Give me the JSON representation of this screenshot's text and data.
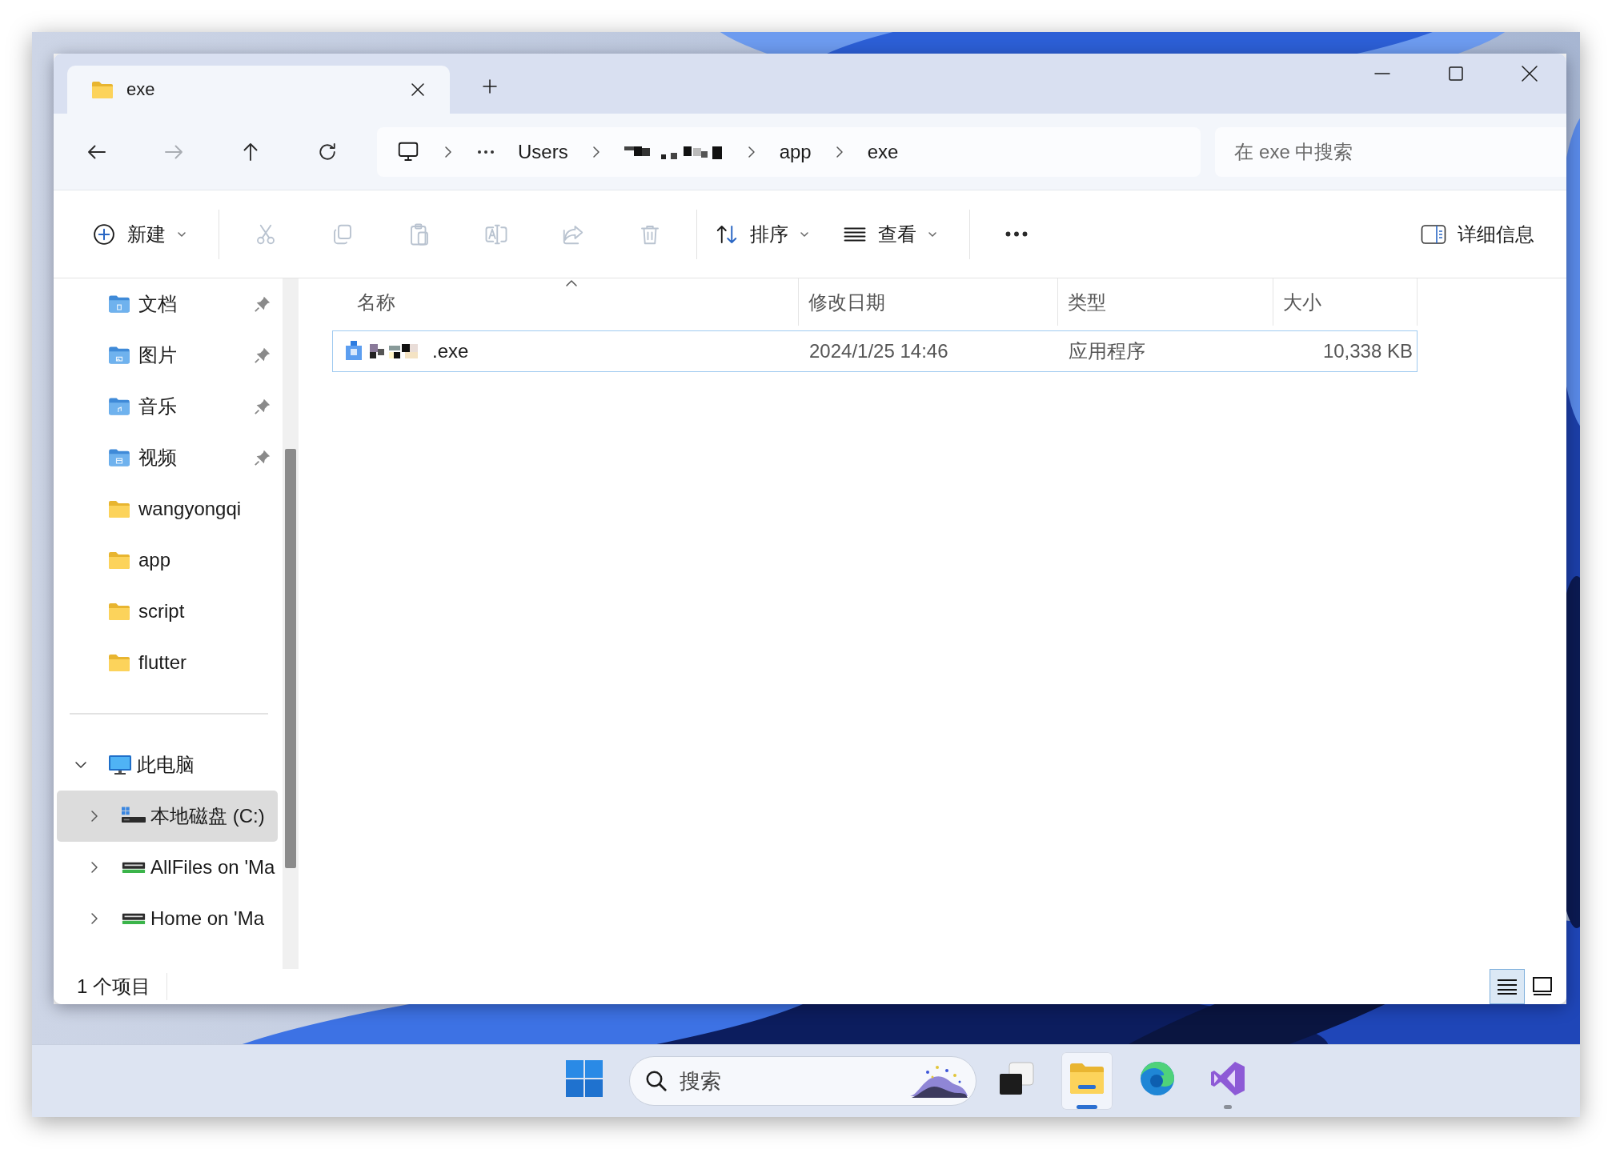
{
  "window": {
    "tabs": [
      {
        "label": "exe",
        "selected": true
      }
    ]
  },
  "navigation": {
    "buttons": [
      {
        "kind": "back",
        "disabled": false
      },
      {
        "kind": "forward",
        "disabled": true
      },
      {
        "kind": "up",
        "disabled": false
      },
      {
        "kind": "refresh",
        "disabled": false
      }
    ],
    "breadcrumb": [
      {
        "kind": "computer"
      },
      {
        "kind": "overflow"
      },
      {
        "kind": "folder",
        "label": "Users"
      },
      {
        "kind": "hidden"
      },
      {
        "kind": "folder",
        "label": "app"
      },
      {
        "kind": "folder",
        "label": "exe"
      }
    ]
  },
  "search": {
    "placeholder": "在 exe 中搜索"
  },
  "toolbar": {
    "items": [
      {
        "kind": "new",
        "label": "新建",
        "disabled": false
      },
      {
        "kind": "separator"
      },
      {
        "kind": "cut",
        "disabled": true
      },
      {
        "kind": "copy",
        "disabled": true
      },
      {
        "kind": "paste",
        "disabled": true
      },
      {
        "kind": "rename",
        "disabled": true
      },
      {
        "kind": "share",
        "disabled": true
      },
      {
        "kind": "delete",
        "disabled": true
      },
      {
        "kind": "separator"
      },
      {
        "kind": "sort",
        "label": "排序",
        "disabled": false
      },
      {
        "kind": "view",
        "label": "查看",
        "disabled": false
      },
      {
        "kind": "separator"
      },
      {
        "kind": "more",
        "disabled": false
      }
    ],
    "details": {
      "label": "详细信息"
    }
  },
  "sidebar": {
    "quick": [
      {
        "label": "文档",
        "kind": "documents",
        "pinned": true,
        "selected": false
      },
      {
        "label": "图片",
        "kind": "pictures",
        "pinned": true,
        "selected": false
      },
      {
        "label": "音乐",
        "kind": "music",
        "pinned": true,
        "selected": false
      },
      {
        "label": "视频",
        "kind": "videos",
        "pinned": true,
        "selected": false
      },
      {
        "label": "wangyongqi",
        "kind": "folder",
        "pinned": false,
        "selected": false
      },
      {
        "label": "app",
        "kind": "folder",
        "pinned": false,
        "selected": false
      },
      {
        "label": "script",
        "kind": "folder",
        "pinned": false,
        "selected": false
      },
      {
        "label": "flutter",
        "kind": "folder",
        "pinned": false,
        "selected": false
      }
    ],
    "tree": [
      {
        "label": "此电脑",
        "kind": "computer",
        "expanded": true,
        "selected": false,
        "children": [
          {
            "label": "本地磁盘 (C:)",
            "kind": "system-drive",
            "expanded": false,
            "selected": true
          },
          {
            "label": "AllFiles on 'Ma",
            "kind": "network-drive",
            "expanded": false,
            "selected": false
          },
          {
            "label": "Home on 'Ma",
            "kind": "network-drive",
            "expanded": false,
            "selected": false
          }
        ]
      }
    ]
  },
  "table": {
    "columns": [
      {
        "label": "名称",
        "sorted": true
      },
      {
        "label": "修改日期",
        "sorted": false
      },
      {
        "label": "类型",
        "sorted": false
      },
      {
        "label": "大小",
        "sorted": false
      }
    ],
    "rows": [
      {
        "name": ".exe",
        "name_blurred": true,
        "modified": "2024/1/25 14:46",
        "type": "应用程序",
        "size": "10,338 KB",
        "selected": false,
        "focused": true
      }
    ]
  },
  "status_bar": {
    "count": "1 个项目",
    "views": [
      {
        "kind": "details",
        "selected": true
      },
      {
        "kind": "tiles",
        "selected": false
      }
    ]
  },
  "taskbar": {
    "items": [
      {
        "kind": "start",
        "active": false,
        "running": false
      },
      {
        "kind": "search",
        "placeholder": "搜索"
      },
      {
        "kind": "task-view",
        "active": false,
        "running": false
      },
      {
        "kind": "explorer",
        "active": true,
        "running": true
      },
      {
        "kind": "edge",
        "active": false,
        "running": false
      },
      {
        "kind": "visual-studio",
        "active": false,
        "running": true
      }
    ]
  }
}
